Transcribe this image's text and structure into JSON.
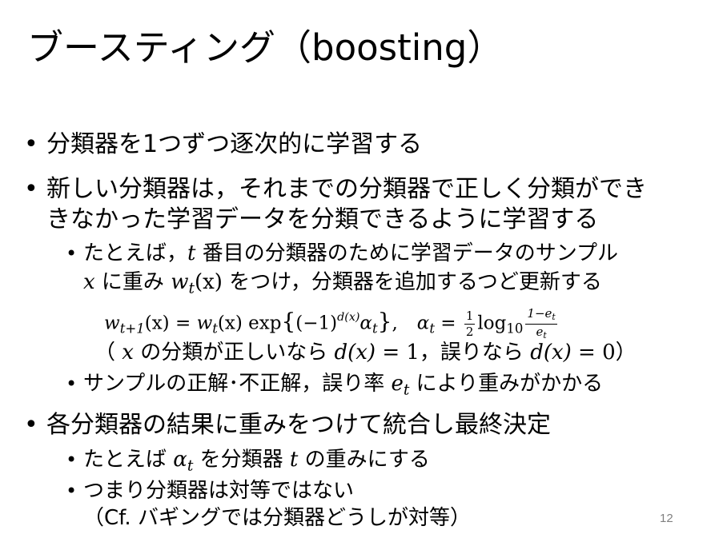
{
  "slide": {
    "title": "ブースティング（boosting）",
    "page_number": "12"
  },
  "bullets": {
    "b1": "分類器を1つずつ逐次的に学習する",
    "b2_line1": "新しい分類器は，それまでの分類器で正しく分類ができ",
    "b2_line2": "きなかった学習データを分類できるように学習する",
    "b2_sub1_pre": "たとえば，",
    "b2_sub1_var_t": "t",
    "b2_sub1_post": " 番目の分類器のために学習データのサンプル",
    "b2_sub1_l2_var_x": "x",
    "b2_sub1_l2_mid": " に重み ",
    "b2_sub1_l2_w": "w",
    "b2_sub1_l2_sub_t": "t",
    "b2_sub1_l2_args": "(x)",
    "b2_sub1_l2_post": " をつけ，分類器を追加するつど更新する",
    "formula": {
      "w": "w",
      "sub_t1": "t+1",
      "arg1": "(x)",
      "eq1": " = ",
      "w2": "w",
      "sub_t2": "t",
      "arg2": "(x)",
      "exp": " exp",
      "brace_open": "{",
      "neg1": "(−1)",
      "sup_d": "d(x)",
      "alpha": "α",
      "sub_t3": "t",
      "brace_close": "}",
      "comma": ",",
      "alpha2": "α",
      "sub_t4": "t",
      "eq2": " = ",
      "half_num": "1",
      "half_den": "2",
      "log": "log",
      "sub_10": "10",
      "frac2_num": "1−e",
      "frac2_num_sub": "t",
      "frac2_den": "e",
      "frac2_den_sub": "t"
    },
    "cond_open": "（ ",
    "cond_x": "x",
    "cond_mid1": " の分類が正しいなら ",
    "cond_d1": "d(x)",
    "cond_eq1": " = 1",
    "cond_mid2": "，誤りなら ",
    "cond_d2": "d(x)",
    "cond_eq2": " = 0",
    "cond_close": "）",
    "b2_sub2_pre": "サンプルの正解･不正解，誤り率 ",
    "b2_sub2_e": "e",
    "b2_sub2_sub_t": "t",
    "b2_sub2_post": " により重みがかかる",
    "b3": "各分類器の結果に重みをつけて統合し最終決定",
    "b3_sub1_pre": "たとえば ",
    "b3_sub1_alpha": "α",
    "b3_sub1_sub_t": "t",
    "b3_sub1_mid": " を分類器 ",
    "b3_sub1_t": "t",
    "b3_sub1_post": " の重みにする",
    "b3_sub2_line1": "つまり分類器は対等ではない",
    "b3_sub2_line2": "（Cf. バギングでは分類器どうしが対等）"
  },
  "bullet_glyph": "•"
}
